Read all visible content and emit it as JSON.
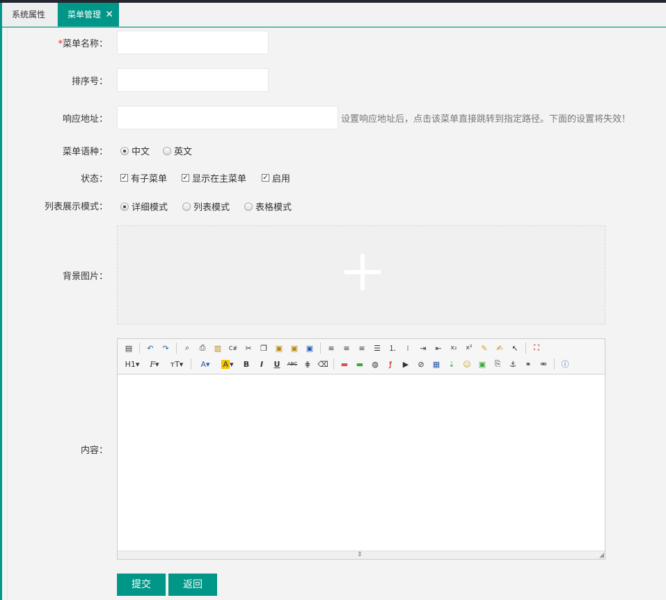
{
  "tabs": [
    {
      "label": "系统属性"
    },
    {
      "label": "菜单管理",
      "close": "✕"
    }
  ],
  "form": {
    "name": {
      "required_mark": "*",
      "label": "菜单名称：",
      "value": ""
    },
    "order": {
      "label": "排序号：",
      "value": ""
    },
    "url": {
      "label": "响应地址：",
      "value": "",
      "hint": "设置响应地址后，点击该菜单直接跳转到指定路径。下面的设置将失效！"
    },
    "language": {
      "label": "菜单语种：",
      "options": [
        "中文",
        "英文"
      ],
      "selected": "中文"
    },
    "status": {
      "label": "状态：",
      "options": [
        "有子菜单",
        "显示在主菜单",
        "启用"
      ],
      "checked": [
        "有子菜单",
        "显示在主菜单",
        "启用"
      ]
    },
    "list_mode": {
      "label": "列表展示模式：",
      "options": [
        "详细模式",
        "列表模式",
        "表格模式"
      ],
      "selected": "详细模式"
    },
    "background": {
      "label": "背景图片：",
      "icon": "plus-icon"
    },
    "content": {
      "label": "内容：",
      "value": ""
    }
  },
  "editor_toolbar": {
    "row1": [
      "source",
      "undo",
      "redo",
      "preview",
      "print",
      "template",
      "code",
      "cut",
      "copy",
      "paste",
      "paste-plain",
      "paste-word",
      "align-left",
      "align-center",
      "align-right",
      "justify",
      "ordered-list",
      "unordered-list",
      "indent",
      "outdent",
      "subscript",
      "superscript",
      "clear-format",
      "select-all",
      "pointer",
      "fullscreen"
    ],
    "row2_labels": {
      "heading": "H1",
      "font": "F",
      "size": "тT",
      "color": "A",
      "highlight": "A",
      "bold": "B",
      "italic": "I",
      "underline": "U",
      "strike": "ABC"
    },
    "row2_icons": [
      "line-height",
      "remove-format",
      "image",
      "multi-image",
      "flash",
      "media",
      "insert-file",
      "table",
      "horizontal-rule",
      "emoticon",
      "picture",
      "pagebreak",
      "anchor",
      "link",
      "unlink",
      "help"
    ]
  },
  "buttons": {
    "submit": "提交",
    "back": "返回"
  },
  "colors": {
    "accent": "#009688",
    "topbar": "#23262e",
    "required": "#e22222"
  }
}
